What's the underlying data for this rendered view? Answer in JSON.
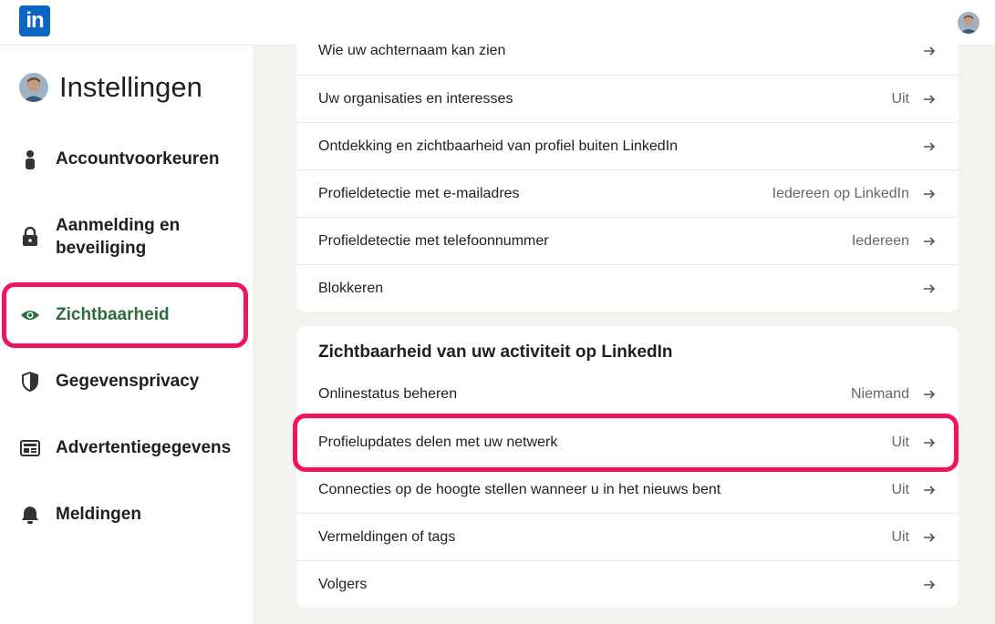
{
  "header": {
    "logo_text": "in",
    "logo_color": "#0a66c2"
  },
  "sidebar": {
    "title": "Instellingen",
    "items": [
      {
        "label": "Accountvoorkeuren",
        "icon": "person-icon"
      },
      {
        "label": "Aanmelding en beveiliging",
        "icon": "lock-icon"
      },
      {
        "label": "Zichtbaarheid",
        "icon": "eye-icon",
        "active": true
      },
      {
        "label": "Gegevensprivacy",
        "icon": "shield-icon"
      },
      {
        "label": "Advertentiegegevens",
        "icon": "newspaper-icon"
      },
      {
        "label": "Meldingen",
        "icon": "bell-icon"
      }
    ],
    "active_color": "#2f6b3d"
  },
  "profile_visibility": {
    "rows": [
      {
        "label": "Wie uw achternaam kan zien",
        "value": ""
      },
      {
        "label": "Uw organisaties en interesses",
        "value": "Uit"
      },
      {
        "label": "Ontdekking en zichtbaarheid van profiel buiten LinkedIn",
        "value": ""
      },
      {
        "label": "Profieldetectie met e-mailadres",
        "value": "Iedereen op LinkedIn"
      },
      {
        "label": "Profieldetectie met telefoonnummer",
        "value": "Iedereen"
      },
      {
        "label": "Blokkeren",
        "value": ""
      }
    ]
  },
  "activity_visibility": {
    "title": "Zichtbaarheid van uw activiteit op LinkedIn",
    "rows": [
      {
        "label": "Onlinestatus beheren",
        "value": "Niemand"
      },
      {
        "label": "Profielupdates delen met uw netwerk",
        "value": "Uit"
      },
      {
        "label": "Connecties op de hoogte stellen wanneer u in het nieuws bent",
        "value": "Uit"
      },
      {
        "label": "Vermeldingen of tags",
        "value": "Uit"
      },
      {
        "label": "Volgers",
        "value": ""
      }
    ]
  },
  "annotation_color": "#f0145a"
}
